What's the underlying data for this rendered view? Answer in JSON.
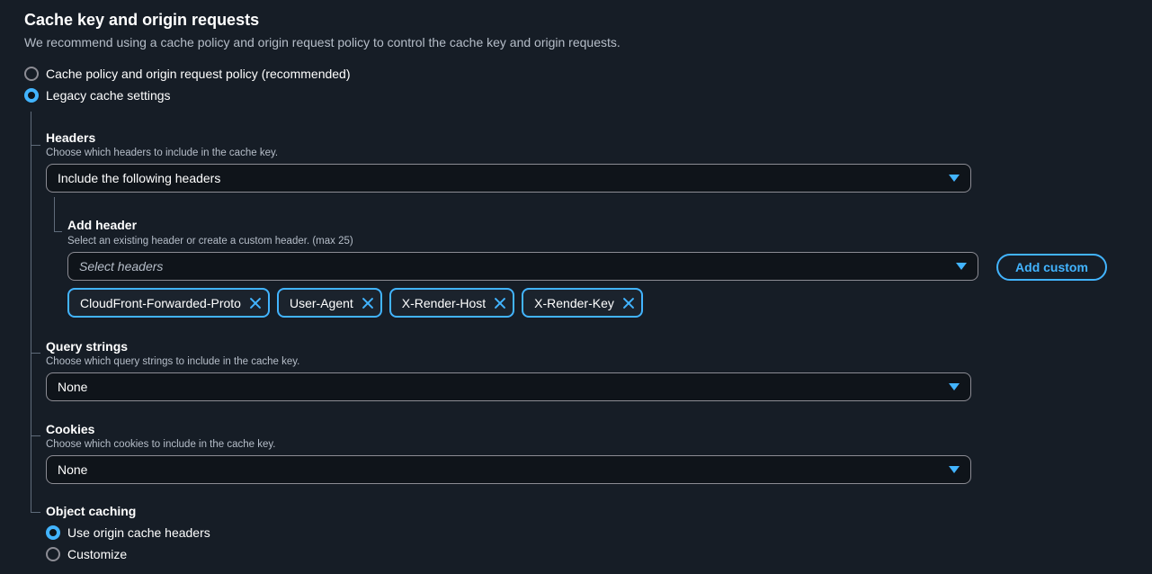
{
  "section": {
    "title": "Cache key and origin requests",
    "description": "We recommend using a cache policy and origin request policy to control the cache key and origin requests."
  },
  "mode_options": [
    {
      "label": "Cache policy and origin request policy (recommended)",
      "checked": false
    },
    {
      "label": "Legacy cache settings",
      "checked": true
    }
  ],
  "headers": {
    "label": "Headers",
    "description": "Choose which headers to include in the cache key.",
    "selected": "Include the following headers",
    "add_header": {
      "label": "Add header",
      "description": "Select an existing header or create a custom header. (max 25)",
      "placeholder": "Select headers",
      "add_custom_label": "Add custom",
      "tokens": [
        "CloudFront-Forwarded-Proto",
        "User-Agent",
        "X-Render-Host",
        "X-Render-Key"
      ]
    }
  },
  "query_strings": {
    "label": "Query strings",
    "description": "Choose which query strings to include in the cache key.",
    "selected": "None"
  },
  "cookies": {
    "label": "Cookies",
    "description": "Choose which cookies to include in the cache key.",
    "selected": "None"
  },
  "object_caching": {
    "label": "Object caching",
    "options": [
      {
        "label": "Use origin cache headers",
        "checked": true
      },
      {
        "label": "Customize",
        "checked": false
      }
    ]
  },
  "colors": {
    "background": "#161d26",
    "accent": "#42b4ff",
    "border": "#8c8c94",
    "muted_text": "#b6bec9"
  }
}
